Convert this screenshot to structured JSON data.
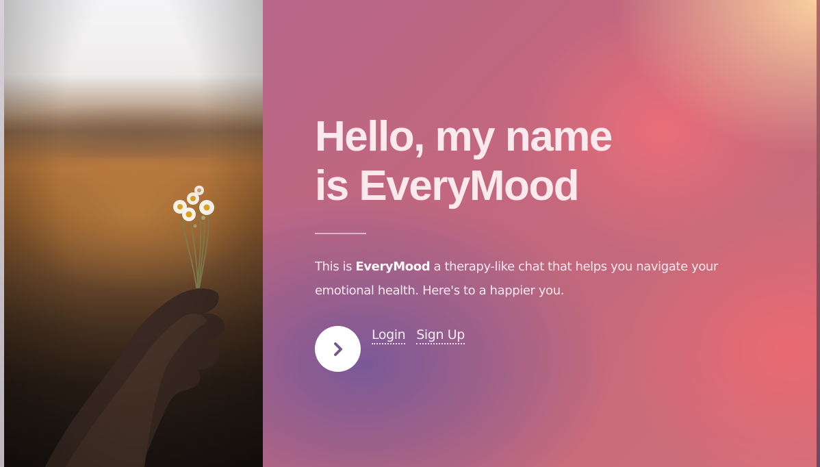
{
  "hero": {
    "title_line1": "Hello, my name",
    "title_line2": "is EveryMood",
    "intro_prefix": "This is ",
    "brand": "EveryMood",
    "intro_suffix": " a therapy-like chat that helps you navigate your emotional health. Here's to a happier you.",
    "go_icon": "chevron-right-icon",
    "login_label": "Login",
    "signup_label": "Sign Up"
  },
  "photo": {
    "alt": "hand holding small daisy flowers"
  },
  "colors": {
    "gradient_purple": "#765898",
    "gradient_pink": "#ee6e78",
    "gradient_peach": "#fcd4a0",
    "text": "#fbe9ee",
    "button_bg": "#ffffff",
    "chevron": "#765a8e"
  }
}
